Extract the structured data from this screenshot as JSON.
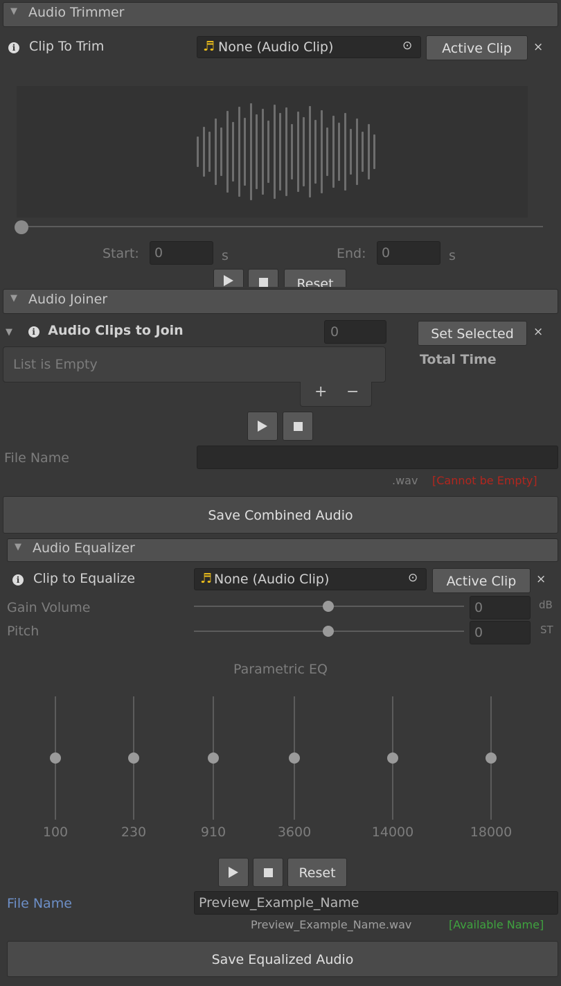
{
  "trimmer": {
    "header": "Audio Trimmer",
    "clip_label": "Clip To Trim",
    "clip_value": "None (Audio Clip)",
    "active_clip": "Active Clip",
    "close": "×",
    "start_label": "Start:",
    "start_value": "0",
    "end_label": "End:",
    "end_value": "0",
    "unit_s": "s",
    "reset": "Reset"
  },
  "joiner": {
    "header": "Audio Joiner",
    "clips_label": "Audio Clips to Join",
    "count": "0",
    "set_selected": "Set Selected",
    "close": "×",
    "list_empty": "List is Empty",
    "total_time": "Total Time",
    "plus": "+",
    "minus": "−",
    "file_name_label": "File Name",
    "file_name_value": "",
    "ext": ".wav",
    "error": "[Cannot be Empty]",
    "save": "Save Combined Audio"
  },
  "equalizer": {
    "header": "Audio Equalizer",
    "clip_label": "Clip to Equalize",
    "clip_value": "None (Audio Clip)",
    "active_clip": "Active Clip",
    "close": "×",
    "gain_label": "Gain Volume",
    "gain_value": "0",
    "gain_unit": "dB",
    "pitch_label": "Pitch",
    "pitch_value": "0",
    "pitch_unit": "ST",
    "eq_title": "Parametric EQ",
    "bands": [
      {
        "freq": "100",
        "gain": 0
      },
      {
        "freq": "230",
        "gain": 0
      },
      {
        "freq": "910",
        "gain": 0
      },
      {
        "freq": "3600",
        "gain": 0
      },
      {
        "freq": "14000",
        "gain": 0
      },
      {
        "freq": "18000",
        "gain": 0
      }
    ],
    "reset": "Reset",
    "file_name_label": "File Name",
    "file_name_value": "Preview_Example_Name",
    "file_name_preview": "Preview_Example_Name.wav",
    "status": "[Available Name]",
    "save": "Save Equalized Audio"
  },
  "icons": {
    "play": "play-icon",
    "stop": "stop-icon",
    "music_note": "music-note-icon",
    "object_picker": "object-picker-icon",
    "info": "info-icon",
    "foldout": "foldout-triangle-icon"
  },
  "colors": {
    "background": "#383838",
    "error": "#b3261e",
    "ok": "#3fa33f",
    "link_label": "#6d8fc7",
    "note": "#f2c21b"
  }
}
